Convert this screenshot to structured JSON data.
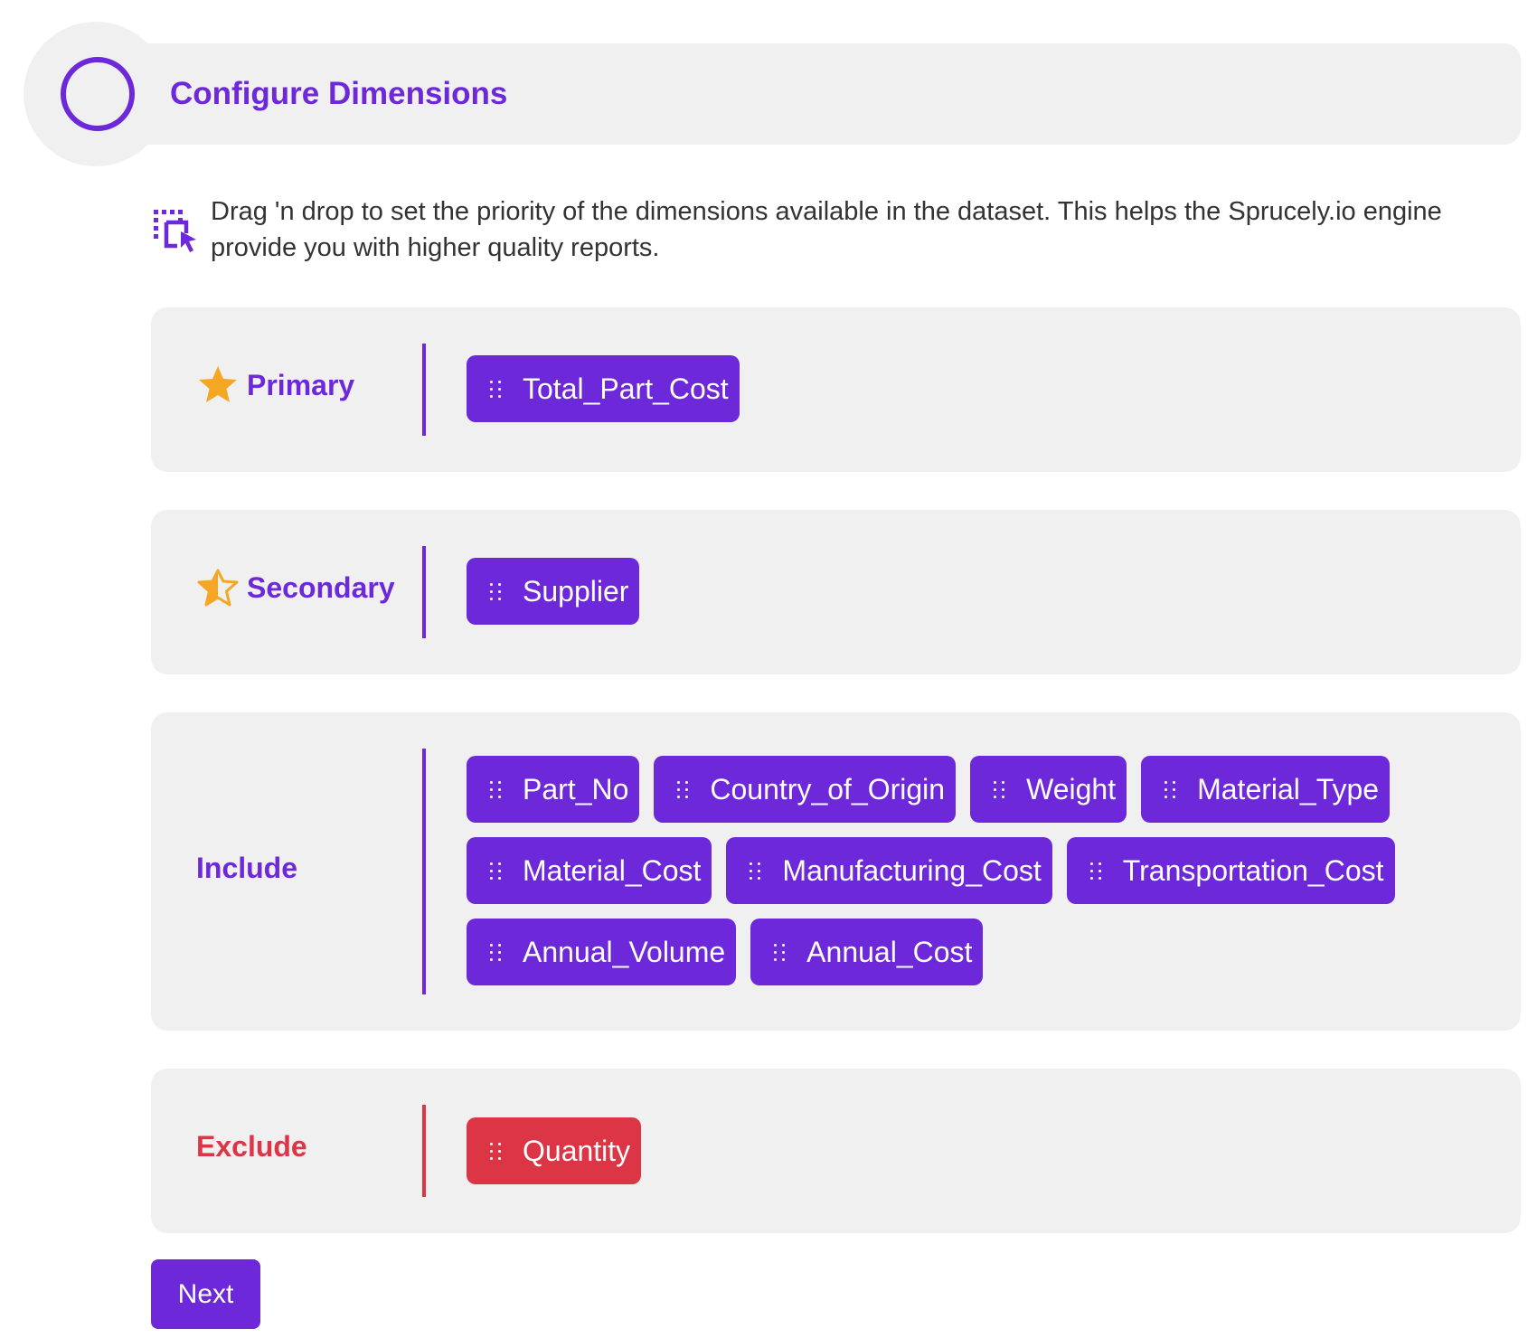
{
  "header": {
    "title": "Configure Dimensions"
  },
  "description": "Drag 'n drop to set the priority of the dimensions available in the dataset. This helps the Sprucely.io engine provide you with higher quality reports.",
  "categories": {
    "primary": {
      "label": "Primary",
      "icon": "star-filled-icon",
      "items": [
        "Total_Part_Cost"
      ]
    },
    "secondary": {
      "label": "Secondary",
      "icon": "star-half-icon",
      "items": [
        "Supplier"
      ]
    },
    "include": {
      "label": "Include",
      "items": [
        "Part_No",
        "Country_of_Origin",
        "Weight",
        "Material_Type",
        "Material_Cost",
        "Manufacturing_Cost",
        "Transportation_Cost",
        "Annual_Volume",
        "Annual_Cost"
      ]
    },
    "exclude": {
      "label": "Exclude",
      "items": [
        "Quantity"
      ]
    }
  },
  "actions": {
    "next_label": "Next"
  },
  "colors": {
    "accent": "#6d28d9",
    "danger": "#dc3545",
    "star": "#f5a623",
    "panel_bg": "#f0f0f0"
  }
}
